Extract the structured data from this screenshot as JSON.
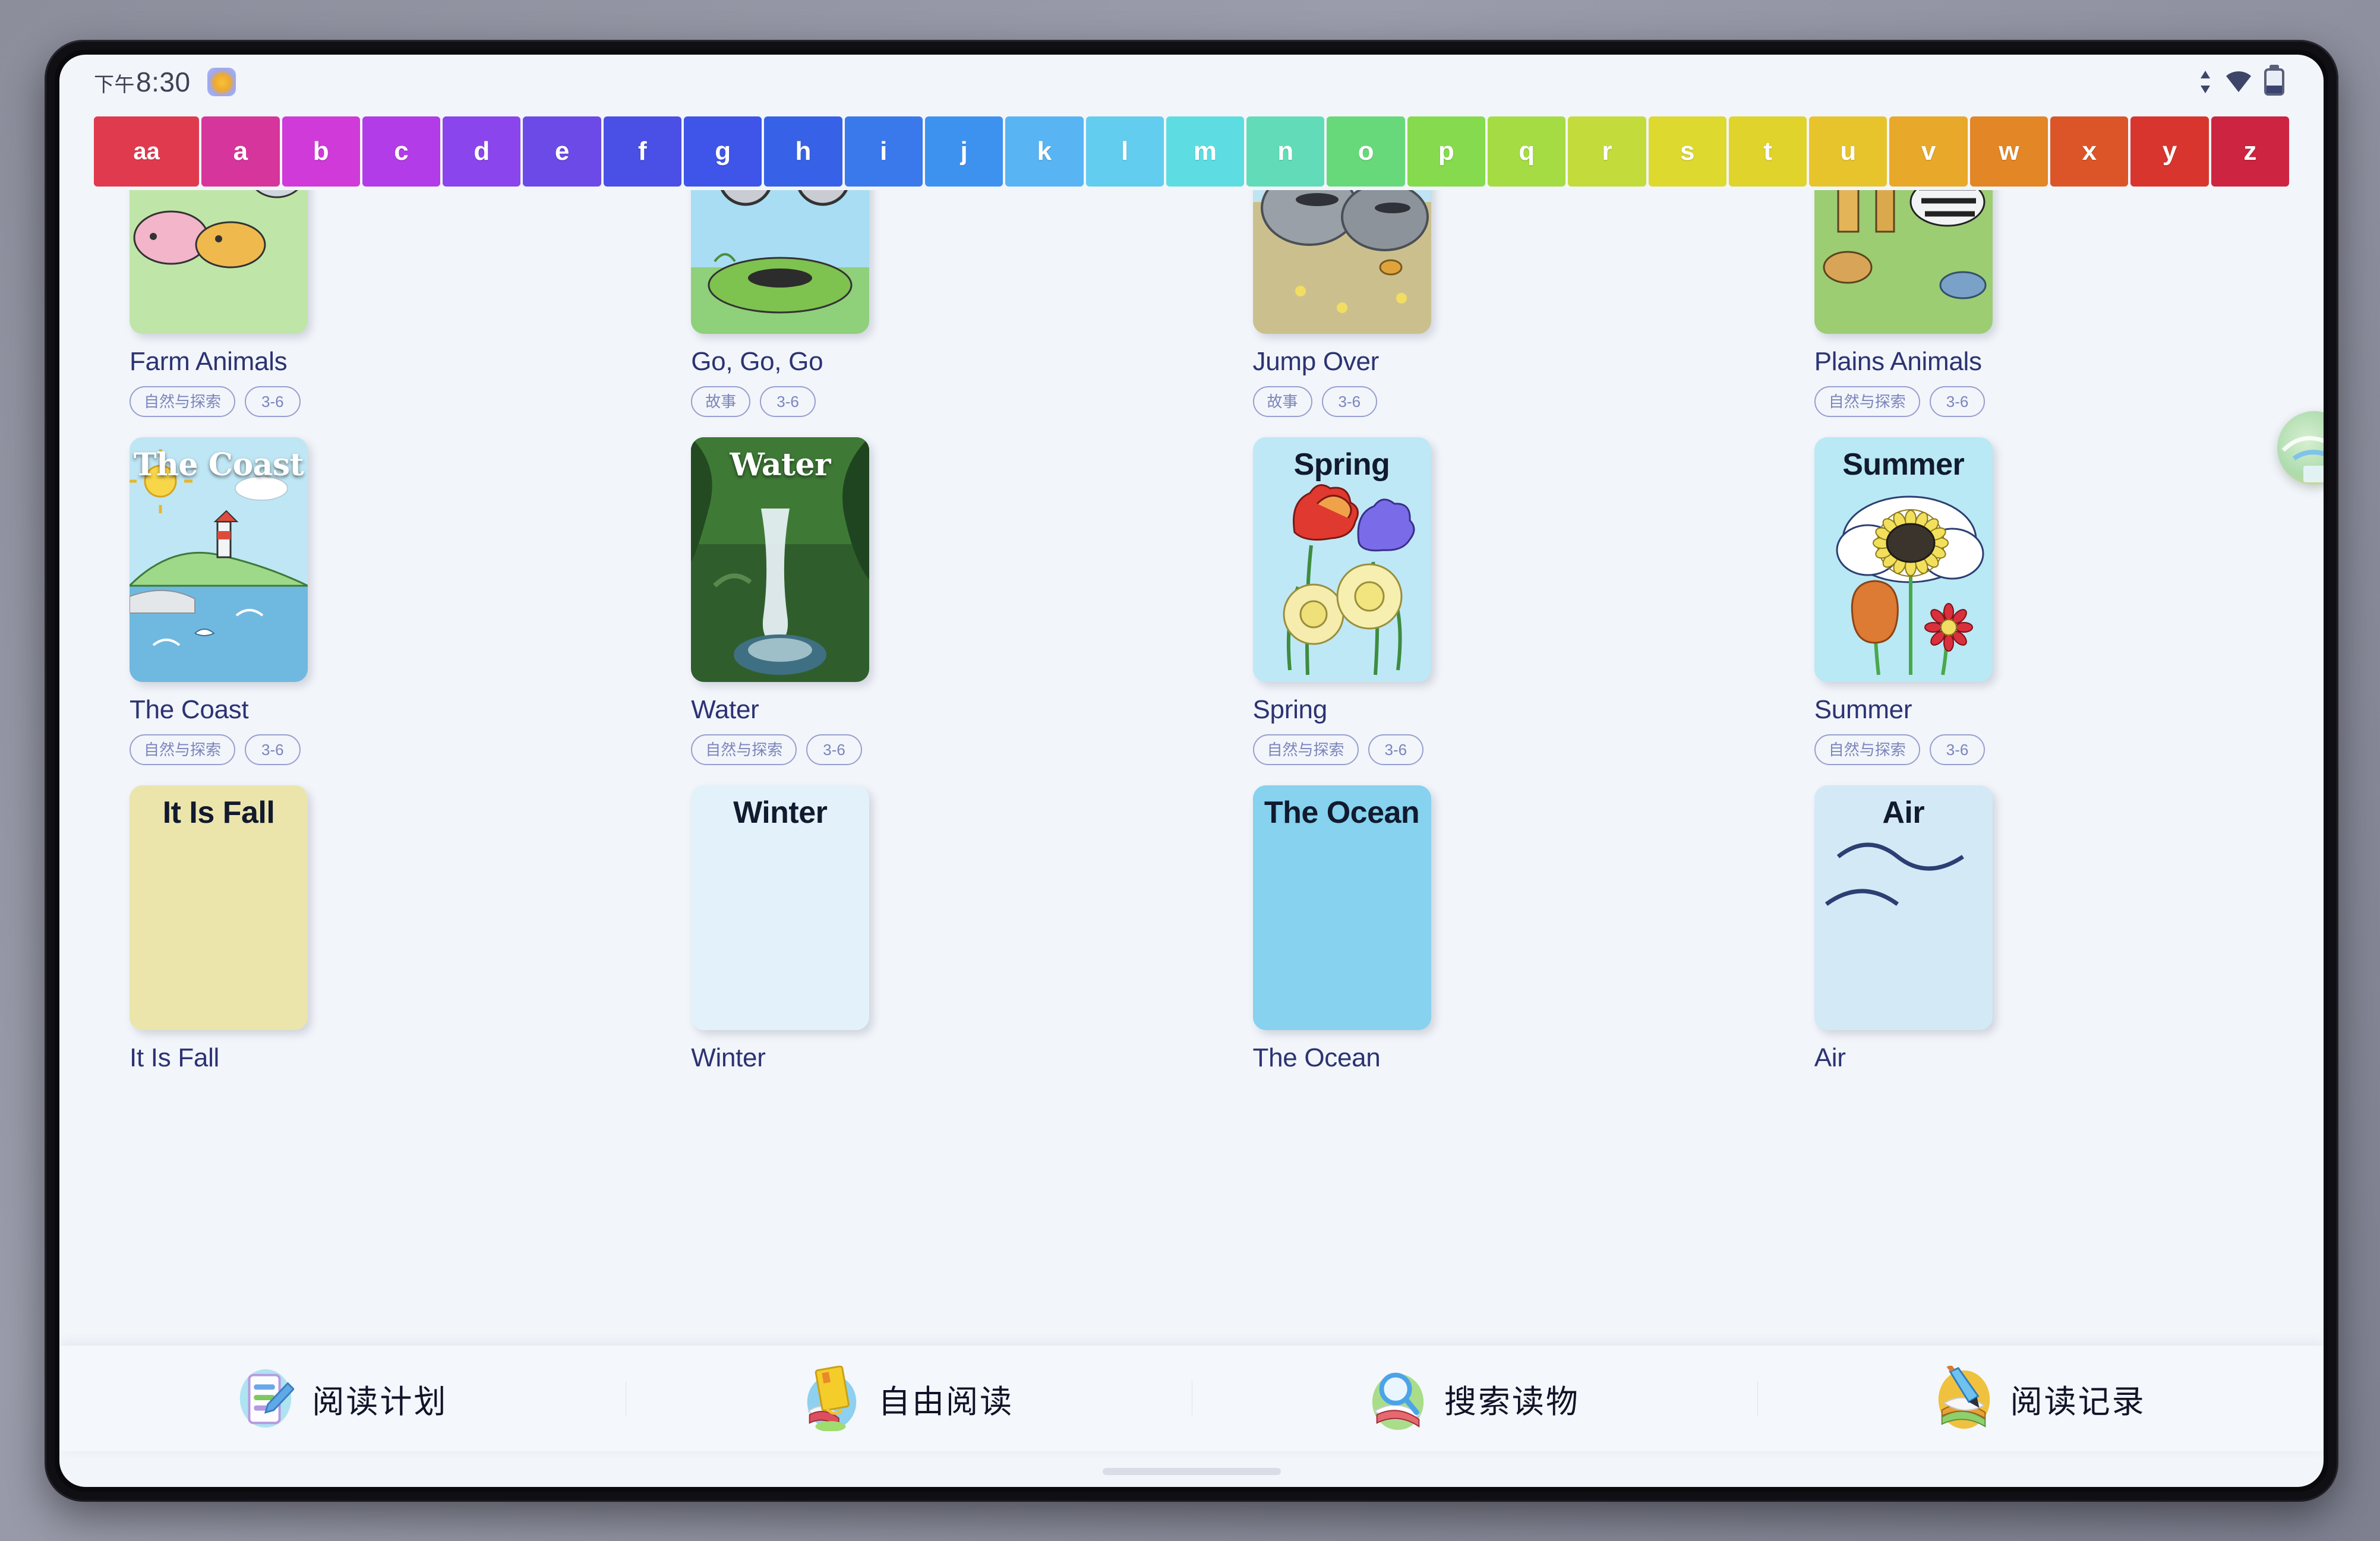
{
  "status_bar": {
    "time": "8:30",
    "ampm_prefix": "下午",
    "app_icon": "book-app-icon",
    "icons": [
      "data-transfer-icon",
      "wifi-icon",
      "battery-icon"
    ]
  },
  "alphabet_rail": {
    "cells": [
      {
        "label": "aa",
        "color": "#e03a4e"
      },
      {
        "label": "a",
        "color": "#d6359c"
      },
      {
        "label": "b",
        "color": "#cf3ad8"
      },
      {
        "label": "c",
        "color": "#b23ce8"
      },
      {
        "label": "d",
        "color": "#8a45ec"
      },
      {
        "label": "e",
        "color": "#6b4ae8"
      },
      {
        "label": "f",
        "color": "#4a4fe6"
      },
      {
        "label": "g",
        "color": "#3f54e8"
      },
      {
        "label": "h",
        "color": "#3761e6"
      },
      {
        "label": "i",
        "color": "#3a79ec"
      },
      {
        "label": "j",
        "color": "#3e92ef"
      },
      {
        "label": "k",
        "color": "#58b4f2"
      },
      {
        "label": "l",
        "color": "#62cdee"
      },
      {
        "label": "m",
        "color": "#5ddde1"
      },
      {
        "label": "n",
        "color": "#62dcb8"
      },
      {
        "label": "o",
        "color": "#68d97a"
      },
      {
        "label": "p",
        "color": "#86da4e"
      },
      {
        "label": "q",
        "color": "#a5dc43"
      },
      {
        "label": "r",
        "color": "#c3dc3c"
      },
      {
        "label": "s",
        "color": "#ddd92f"
      },
      {
        "label": "t",
        "color": "#e0d32c"
      },
      {
        "label": "u",
        "color": "#e7c42c"
      },
      {
        "label": "v",
        "color": "#e8a82a"
      },
      {
        "label": "w",
        "color": "#e28626"
      },
      {
        "label": "x",
        "color": "#dc5528"
      },
      {
        "label": "y",
        "color": "#d9352f"
      },
      {
        "label": "z",
        "color": "#cc2441"
      }
    ]
  },
  "books": [
    {
      "title": "Farm Animals",
      "cover_title": "",
      "category": "自然与探索",
      "age": "3-6",
      "cover_art": "farm-animals"
    },
    {
      "title": "Go, Go, Go",
      "cover_title": "",
      "category": "故事",
      "age": "3-6",
      "cover_art": "go-go-go"
    },
    {
      "title": "Jump Over",
      "cover_title": "",
      "category": "故事",
      "age": "3-6",
      "cover_art": "jump-over"
    },
    {
      "title": "Plains Animals",
      "cover_title": "",
      "category": "自然与探索",
      "age": "3-6",
      "cover_art": "plains-animals"
    },
    {
      "title": "The Coast",
      "cover_title": "The Coast",
      "category": "自然与探索",
      "age": "3-6",
      "cover_art": "the-coast"
    },
    {
      "title": "Water",
      "cover_title": "Water",
      "category": "自然与探索",
      "age": "3-6",
      "cover_art": "water"
    },
    {
      "title": "Spring",
      "cover_title": "Spring",
      "category": "自然与探索",
      "age": "3-6",
      "cover_art": "spring"
    },
    {
      "title": "Summer",
      "cover_title": "Summer",
      "category": "自然与探索",
      "age": "3-6",
      "cover_art": "summer"
    },
    {
      "title": "It Is Fall",
      "cover_title": "It Is Fall",
      "category": "",
      "age": "",
      "cover_art": "it-is-fall"
    },
    {
      "title": "Winter",
      "cover_title": "Winter",
      "category": "",
      "age": "",
      "cover_art": "winter"
    },
    {
      "title": "The Ocean",
      "cover_title": "The Ocean",
      "category": "",
      "age": "",
      "cover_art": "the-ocean"
    },
    {
      "title": "Air",
      "cover_title": "Air",
      "category": "",
      "age": "",
      "cover_art": "air"
    }
  ],
  "bottom_nav": [
    {
      "label": "阅读计划",
      "icon": "reading-plan-icon"
    },
    {
      "label": "自由阅读",
      "icon": "free-reading-icon"
    },
    {
      "label": "搜索读物",
      "icon": "search-books-icon"
    },
    {
      "label": "阅读记录",
      "icon": "reading-record-icon"
    }
  ],
  "floating_button": {
    "icon": "globe-badge-icon"
  }
}
